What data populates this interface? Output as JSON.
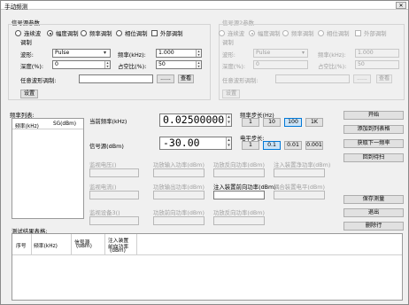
{
  "window": {
    "title": "手动频测",
    "close": "✕"
  },
  "signal_params": {
    "title": "信号源参数",
    "modes": [
      "连续波",
      "幅度调制",
      "频率调制",
      "相位调制"
    ],
    "selected_mode": 1,
    "external_mod": "外部调制",
    "mod_line2": "调制",
    "waveform_label": "波形:",
    "waveform_value": "Pulse",
    "mod_freq_label": "频率(kHz):",
    "mod_freq_value": "1.000",
    "depth_label": "深度(%):",
    "depth_value": "0",
    "duty_label": "占空比(%):",
    "duty_value": "50",
    "arb_label": "任意波形调制:",
    "arb_value": "",
    "browse": "......",
    "view": "查看",
    "set": "设置"
  },
  "signal_params2": {
    "title": "信号源2参数",
    "modes": [
      "连续波",
      "幅度调制",
      "频率调制",
      "相位调制"
    ],
    "selected_mode": 1,
    "external_mod": "外部调制",
    "mod_line2": "调制",
    "waveform_label": "波形:",
    "waveform_value": "Pulse",
    "mod_freq_label": "频率(kHz):",
    "mod_freq_value": "1.000",
    "depth_label": "深度(%):",
    "depth_value": "0",
    "duty_label": "占空比(%):",
    "duty_value": "50",
    "arb_label": "任意波形调制:",
    "browse": "......",
    "view": "查看",
    "set": "设置"
  },
  "freq_list": {
    "title": "频率列表:",
    "columns": [
      "频率(kHz)",
      "SG(dBm)"
    ]
  },
  "current_freq": {
    "label": "当前频率(kHz)",
    "value": "0.02500000"
  },
  "signal_level": {
    "label": "信号源(dBm)",
    "value": "-30.00"
  },
  "freq_step": {
    "label": "频率步长(Hz)",
    "options": [
      "1",
      "10",
      "100",
      "1K"
    ],
    "selected": 2
  },
  "level_step": {
    "label": "电平步长:",
    "options": [
      "1",
      "0.1",
      "0.01",
      "0.001"
    ],
    "selected": 1
  },
  "readouts": {
    "row1": [
      "监视电压()",
      "功放输入功率(dBm)",
      "功放反向功率(dBm)",
      "注入装置净功率(dBm)"
    ],
    "row2": [
      "监视电流()",
      "功放输出功率(dBm)",
      "注入装置前向功率(dBm)",
      "耦合装置电平(dBm)"
    ],
    "row3": [
      "监视设备3()",
      "功放前向功率(dBm)",
      "功放反向功率(dBm)"
    ]
  },
  "actions": {
    "start": "开始",
    "add_to_list": "添加到列表格",
    "get_next": "获取下一频率",
    "back_to_start": "回到待扫",
    "save": "保存测量",
    "exit": "退出",
    "delete_row": "删除行"
  },
  "results": {
    "title": "测试结果表格:",
    "columns": [
      "序号",
      "频率(kHz)",
      "信号源(dBm)",
      "注入装置前向功率(dBm)"
    ],
    "col4_line1": "注入装置",
    "col4_line2": "前向功率",
    "col4_line3": "(dBm)",
    "col3_line1": "信号源",
    "col3_line2": "(dBm)"
  }
}
